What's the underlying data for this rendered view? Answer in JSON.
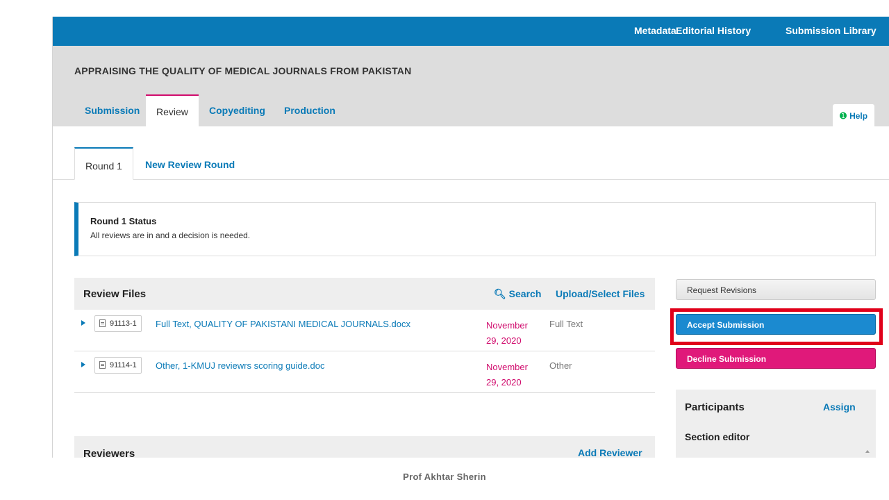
{
  "topnav": {
    "metadata": "Metadata",
    "editorial_history": "Editorial History",
    "submission_library": "Submission Library"
  },
  "submission": {
    "title": "APPRAISING THE QUALITY OF MEDICAL JOURNALS FROM PAKISTAN"
  },
  "stage_tabs": [
    {
      "label": "Submission",
      "active": false
    },
    {
      "label": "Review",
      "active": true
    },
    {
      "label": "Copyediting",
      "active": false
    },
    {
      "label": "Production",
      "active": false
    }
  ],
  "help": {
    "label": "Help"
  },
  "round_tabs": {
    "round1": "Round 1",
    "new_round": "New Review Round"
  },
  "round_status": {
    "heading": "Round 1 Status",
    "text": "All reviews are in and a decision is needed."
  },
  "review_files": {
    "title": "Review Files",
    "search_label": "Search",
    "upload_label": "Upload/Select Files",
    "rows": [
      {
        "id": "91113-1",
        "name": "Full Text, QUALITY OF PAKISTANI MEDICAL JOURNALS.docx",
        "date_line1": "November",
        "date_line2": "29, 2020",
        "type": "Full Text"
      },
      {
        "id": "91114-1",
        "name": "Other, 1-KMUJ reviewrs scoring guide.doc",
        "date_line1": "November",
        "date_line2": "29, 2020",
        "type": "Other"
      }
    ]
  },
  "reviewers": {
    "title": "Reviewers",
    "add_label": "Add Reviewer"
  },
  "decisions": {
    "request_revisions": "Request Revisions",
    "accept": "Accept Submission",
    "decline": "Decline Submission"
  },
  "participants": {
    "title": "Participants",
    "assign_label": "Assign",
    "role": "Section editor"
  },
  "caption": "Prof Akhtar Sherin",
  "colors": {
    "brand_blue": "#0a7ab7",
    "accent_pink": "#d00a6c",
    "highlight_red": "#e0001a"
  }
}
